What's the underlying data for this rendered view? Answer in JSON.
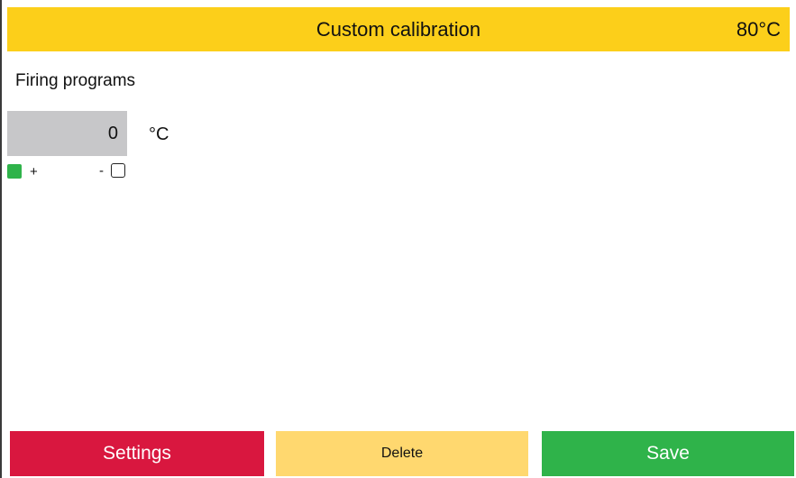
{
  "header": {
    "title": "Custom calibration",
    "temperature": "80°C",
    "background_color": "#fccf1a"
  },
  "section": {
    "label": "Firing programs"
  },
  "calibration": {
    "value": "0",
    "unit": "°C",
    "plus_label": "+",
    "minus_label": "-",
    "plus_selected": true,
    "minus_selected": false,
    "selected_color": "#2fb34a"
  },
  "buttons": {
    "settings": {
      "label": "Settings",
      "color": "#d9173f"
    },
    "delete": {
      "label": "Delete",
      "color": "#ffd86f"
    },
    "save": {
      "label": "Save",
      "color": "#2fb34a"
    }
  }
}
